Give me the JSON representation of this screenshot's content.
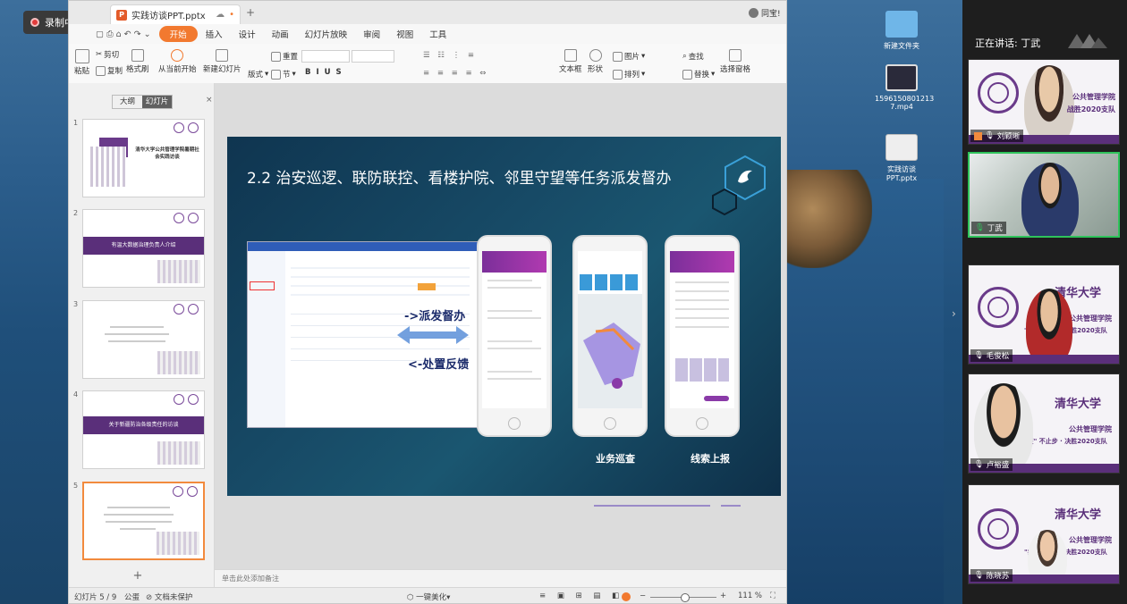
{
  "recording": {
    "label": "录制中"
  },
  "desktop": {
    "icons": [
      {
        "label": "新建文件夹"
      },
      {
        "label": "1596150801213 7.mp4"
      },
      {
        "label": "实践访谈PPT.pptx"
      }
    ]
  },
  "window": {
    "tab_title": "实践访谈PPT.pptx",
    "user": "同宝!",
    "menu": [
      "开始",
      "插入",
      "设计",
      "动画",
      "幻灯片放映",
      "审阅",
      "视图",
      "工具"
    ],
    "active_menu": "开始",
    "ribbon": {
      "cut": "剪切",
      "copy": "复制",
      "paste": "粘贴",
      "format_painter": "格式刷",
      "from_current": "从当前开始",
      "new_slide": "新建幻灯片",
      "layout": "版式",
      "section": "节",
      "reset": "重置",
      "textbox": "文本框",
      "shape": "形状",
      "arrange": "排列",
      "picture": "图片",
      "find": "查找",
      "replace": "替换",
      "selection_pane": "选择窗格"
    },
    "panel_tabs": [
      "大纲",
      "幻灯片"
    ],
    "thumbnails": [
      {
        "num": "1",
        "title": "清华大学公共管理学院暑期社会实践访谈"
      },
      {
        "num": "2",
        "title": "有温大数据治理负责人介绍"
      },
      {
        "num": "3",
        "title": ""
      },
      {
        "num": "4",
        "title": "关于新疆防治各级责任的访谈"
      },
      {
        "num": "5",
        "title": ""
      }
    ],
    "add_slide": "+",
    "slide": {
      "title": "2.2 治安巡逻、联防联控、看楼护院、邻里守望等任务派发督办",
      "dispatch": "->派发督办",
      "feedback": "<-处置反馈",
      "caption_patrol": "业务巡查",
      "caption_report": "线索上报"
    },
    "notes_placeholder": "单击此处添加备注",
    "status": {
      "slide_count": "幻灯片 5 / 9",
      "theme": "公蛋",
      "protect": "文档未保护",
      "beautify": "一键美化",
      "zoom": "111 %"
    }
  },
  "meeting": {
    "speaking": "正在讲话: 丁武",
    "participants": [
      {
        "name": "刘颖晰",
        "banner": "公共管理学院",
        "slogan": "战胜2020支队"
      },
      {
        "name": "丁武",
        "banner": "",
        "slogan": ""
      },
      {
        "name": "毛俊松",
        "banner": "公共管理学院",
        "slogan": "\"疫\" 不止步 · 决胜2020支队"
      },
      {
        "name": "卢裕盛",
        "banner": "公共管理学院",
        "slogan": "\"疫\" 不止步 · 决胜2020支队"
      },
      {
        "name": "陈晓苏",
        "banner": "公共管理学院",
        "slogan": "\"疫\" 不止步 · 决胜2020支队"
      }
    ],
    "university": "清华大学"
  }
}
